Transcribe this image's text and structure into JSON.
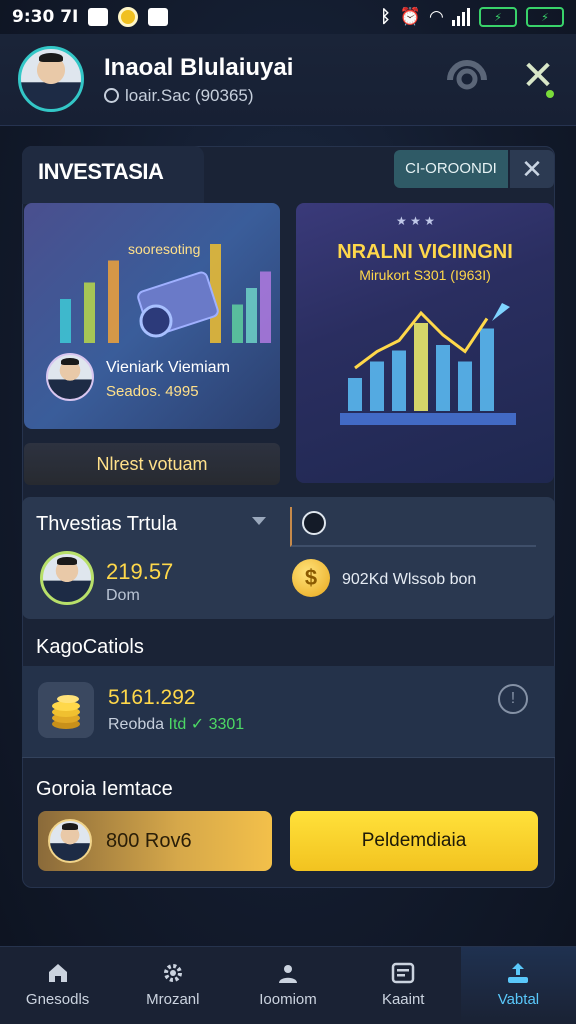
{
  "status_bar": {
    "time": "9:30 7I"
  },
  "header": {
    "title": "Inaoal Blulaiuyai",
    "subtitle": "loair.Sac (90365)"
  },
  "brand": {
    "name": "INVESTASIA",
    "code": "CI-OROONDI"
  },
  "promo_left": {
    "label": "sooresoting",
    "name": "Vieniark Viemiam",
    "score": "Seados. 4995",
    "button": "Nlrest votuam",
    "bars": [
      0.4,
      0.55,
      0.75,
      0.9,
      0.35,
      0.5,
      0.65
    ]
  },
  "promo_right": {
    "title": "NRALNI VICIINGNI",
    "subtitle": "Mirukort S301 (I963I)",
    "bars": [
      0.3,
      0.45,
      0.55,
      0.8,
      0.6,
      0.45,
      0.75
    ]
  },
  "trend": {
    "title": "Thvestias Trtula",
    "value": "219.57",
    "unit": "Dom",
    "coin_label": "902Kd Wlssob bon"
  },
  "balance_section": {
    "title": "KagoCatiols",
    "value": "5161.292",
    "sub_prefix": "Reobda ",
    "sub_green": "Itd ✓ 3301"
  },
  "action_section": {
    "title": "Goroia Iemtace",
    "secondary_label": "800 Rov6",
    "primary_label": "Peldemdiaia"
  },
  "nav": [
    {
      "label": "Gnesodls",
      "icon": "home-icon"
    },
    {
      "label": "Mrozanl",
      "icon": "gear-icon"
    },
    {
      "label": "Ioomiom",
      "icon": "user-icon"
    },
    {
      "label": "Kaaint",
      "icon": "card-icon"
    },
    {
      "label": "Vabtal",
      "icon": "wallet-icon"
    }
  ],
  "colors": {
    "accent": "#ffd84a",
    "active_nav": "#5ac8fa",
    "card": "#1a2336"
  }
}
